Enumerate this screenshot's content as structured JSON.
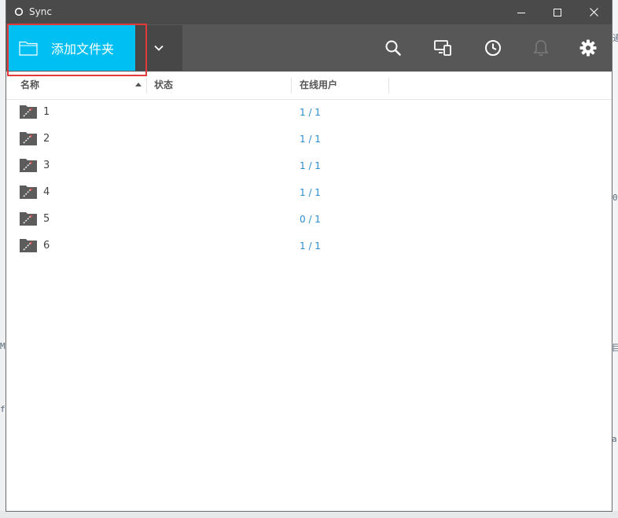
{
  "window": {
    "title": "Sync"
  },
  "toolbar": {
    "add_folder_label": "添加文件夹",
    "icons": [
      "folder-icon",
      "chevron-down-icon",
      "search-icon",
      "devices-icon",
      "history-icon",
      "bell-icon",
      "gear-icon"
    ]
  },
  "table": {
    "columns": {
      "name": "名称",
      "status": "状态",
      "peers": "在线用户"
    },
    "sort": {
      "column": "name",
      "direction": "ascending"
    },
    "rows": [
      {
        "name": "1",
        "status": "",
        "peers": "1 / 1"
      },
      {
        "name": "2",
        "status": "",
        "peers": "1 / 1"
      },
      {
        "name": "3",
        "status": "",
        "peers": "1 / 1"
      },
      {
        "name": "4",
        "status": "",
        "peers": "1 / 1"
      },
      {
        "name": "5",
        "status": "",
        "peers": "0 / 1"
      },
      {
        "name": "6",
        "status": "",
        "peers": "1 / 1"
      }
    ]
  },
  "background_fragments": [
    "通",
    "0",
    "目",
    "M",
    "f",
    "a"
  ],
  "colors": {
    "titlebar": "#4a4a4a",
    "toolbar": "#575757",
    "accent": "#00bff3",
    "dropdown": "#474747",
    "highlight": "#e2393a",
    "link": "#2a8cd0"
  }
}
